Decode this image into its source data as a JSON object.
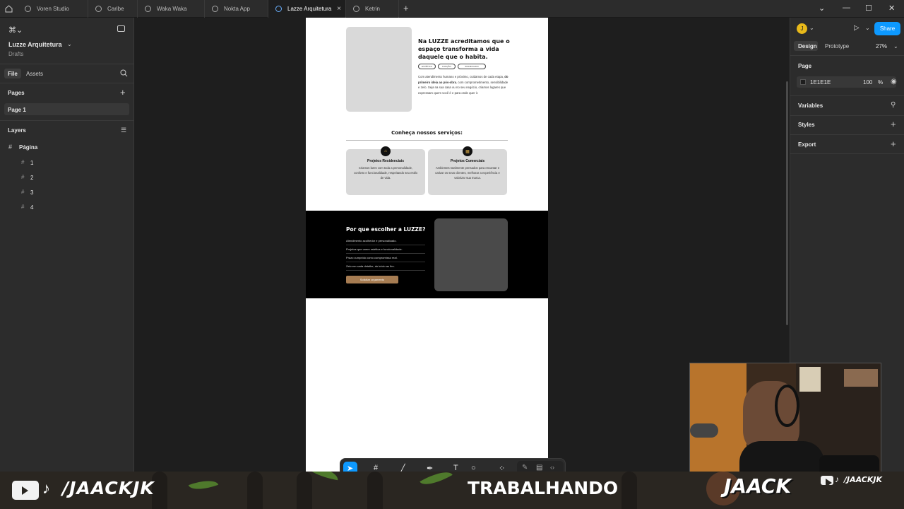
{
  "browser": {
    "tabs": [
      {
        "label": "Voren Studio"
      },
      {
        "label": "Caribe"
      },
      {
        "label": "Waka Waka"
      },
      {
        "label": "Nokta App"
      },
      {
        "label": "Lazze Arquitetura"
      },
      {
        "label": "Ketrin"
      }
    ],
    "new_tab": "+"
  },
  "left_panel": {
    "file_name": "Luzze Arquitetura",
    "file_location": "Drafts",
    "tabs": {
      "file": "File",
      "assets": "Assets"
    },
    "pages_heading": "Pages",
    "pages": [
      "Page 1"
    ],
    "layers_heading": "Layers",
    "layers": {
      "root": "Página",
      "children": [
        "1",
        "2",
        "3",
        "4"
      ]
    }
  },
  "design_frame": {
    "hero_heading": "Na LUZZE acreditamos que o espaço transforma a vida daquele que o habita.",
    "tags": [
      "ESTÉTICA",
      "FUNÇÃO",
      "SIGNIFICADO"
    ],
    "hero_body_1": "Com atendimento humano e próximo, cuidamos de cada etapa, ",
    "hero_body_bold": "do primeiro ideia ao pós-obra",
    "hero_body_2": ", com comprometimento, sensibilidade e zelo. Seja na sua casa ou no seu negócio, criamos lugares que expressam quem você é e para onde quer ir.",
    "services_heading": "Conheça nossos serviços:",
    "services": [
      {
        "icon": "home-icon",
        "title": "Projetos Residenciais",
        "text": "Criamos lares com toda a personalidade, conforto e funcionalidade, respeitando seu estilo de vida."
      },
      {
        "icon": "building-icon",
        "title": "Projetos Comerciais",
        "text": "Ambientes totalmente pensados para encantar e cativar os seus clientes, melhorar a experiência e valorizar sua marca."
      }
    ],
    "why_heading": "Por que escolher a LUZZE?",
    "why_items": [
      "Atendimento acolhedor e personalizado.",
      "Projetos que unem estética e funcionalidade.",
      "Prazo cumprido como compromisso real.",
      "Zelo em cada detalhe, do início ao fim."
    ],
    "cta_label": "Solicitar orçamento"
  },
  "right_panel": {
    "avatar_letter": "J",
    "share_label": "Share",
    "tabs": {
      "design": "Design",
      "prototype": "Prototype"
    },
    "zoom": "27%",
    "page_heading": "Page",
    "page_color_hex": "1E1E1E",
    "page_opacity": "100",
    "percent_sign": "%",
    "sections": [
      "Variables",
      "Styles",
      "Export"
    ]
  },
  "stream_overlay": {
    "handle_left": "/JAACKJK",
    "status": "TRABALHANDO",
    "logo": "JAACK",
    "handle_right": "/JAACKJK"
  },
  "colors": {
    "accent_blue": "#0d99ff",
    "cta_bronze": "#a67c52",
    "canvas_bg": "#1E1E1E"
  }
}
